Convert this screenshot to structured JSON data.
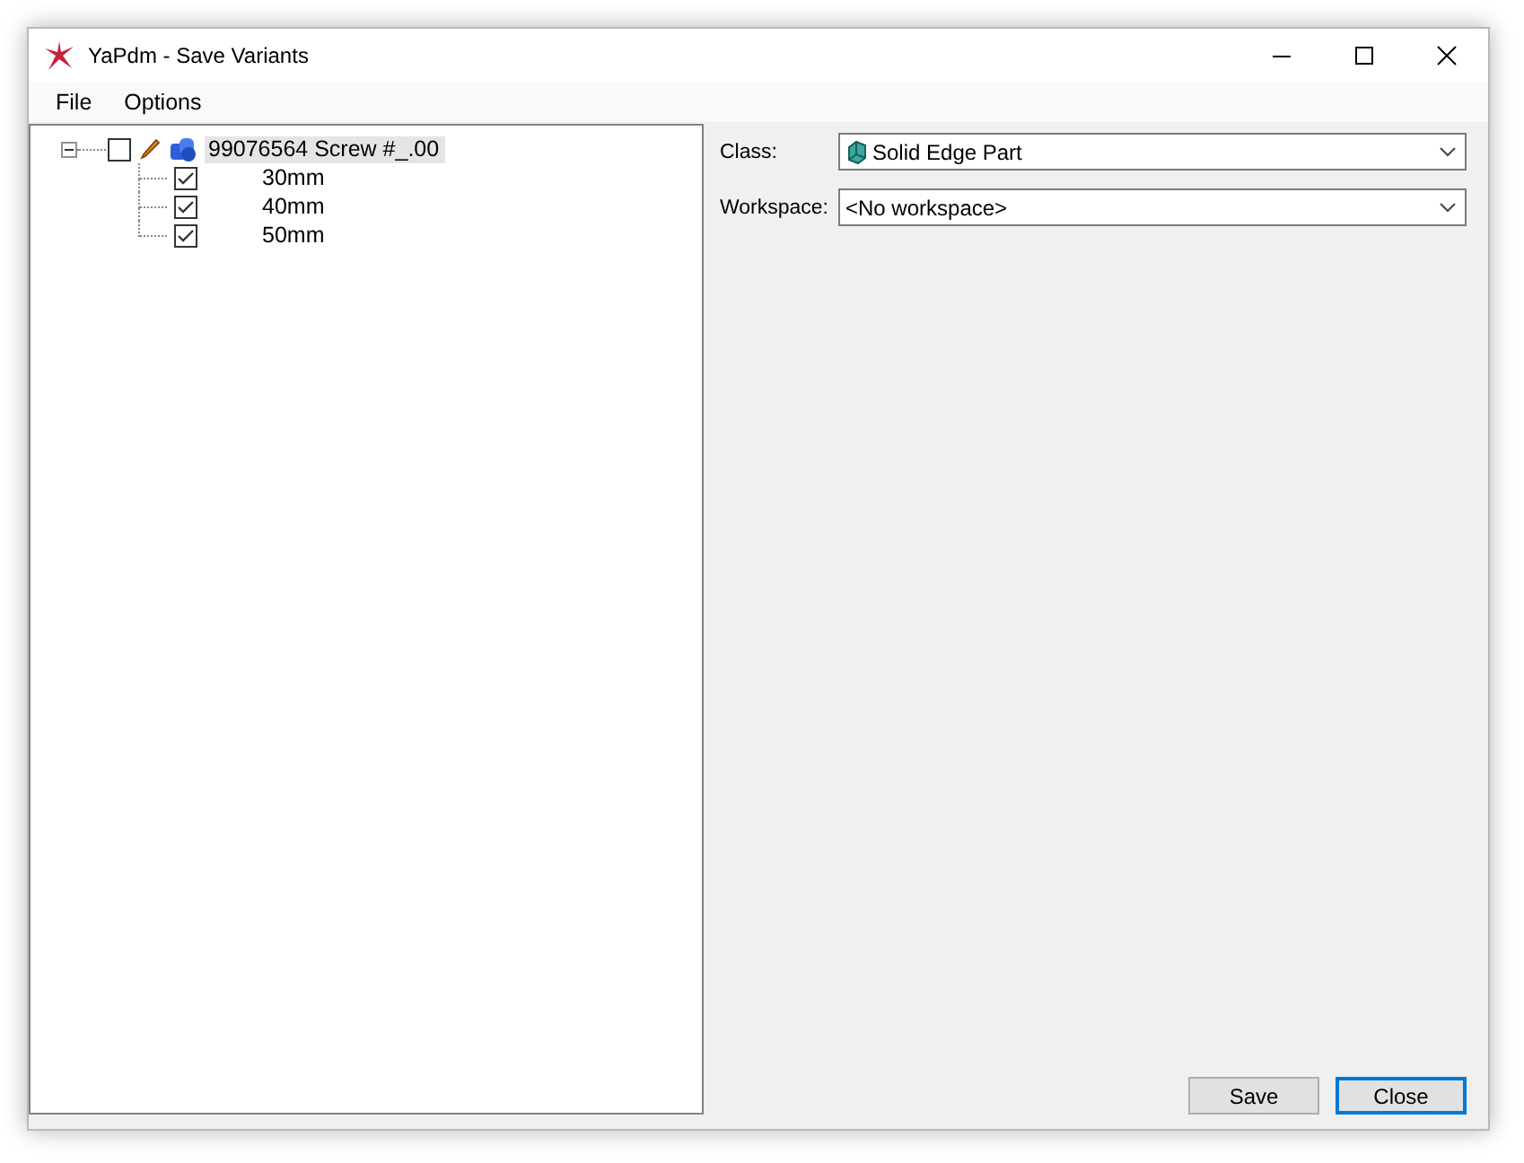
{
  "window": {
    "title": "YaPdm - Save Variants"
  },
  "menu": [
    {
      "label": "File"
    },
    {
      "label": "Options"
    }
  ],
  "tree": [
    {
      "label": "99076564 Screw #_.00",
      "checked": false,
      "selected": true,
      "expanded": true,
      "children": [
        {
          "label": "30mm",
          "checked": true,
          "selected": false
        },
        {
          "label": "40mm",
          "checked": true,
          "selected": false
        },
        {
          "label": "50mm",
          "checked": true,
          "selected": false
        }
      ]
    }
  ],
  "fields": [
    {
      "label": "Class:",
      "value": "Solid Edge Part",
      "kind": "part"
    },
    {
      "label": "Workspace:",
      "value": "<No workspace>",
      "kind": "plain"
    }
  ],
  "buttons": [
    {
      "label": "Save",
      "focused": false
    },
    {
      "label": "Close",
      "focused": true
    }
  ]
}
